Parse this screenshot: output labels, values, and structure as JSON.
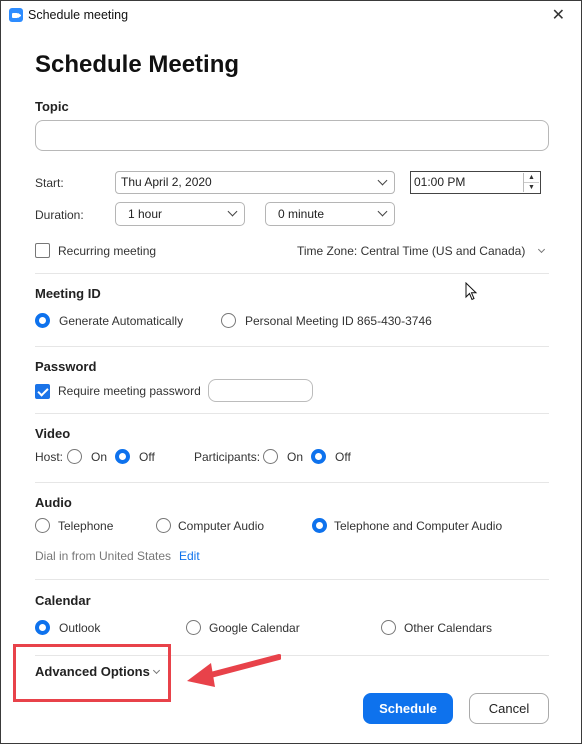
{
  "window": {
    "title": "Schedule meeting",
    "close_glyph": "✕"
  },
  "heading": "Schedule Meeting",
  "topic": {
    "label": "Topic",
    "value": ""
  },
  "start": {
    "label": "Start:",
    "date": "Thu  April 2, 2020",
    "time": "01:00 PM"
  },
  "duration": {
    "label": "Duration:",
    "hours": "1 hour",
    "minutes": "0 minute"
  },
  "recurring": {
    "label": "Recurring meeting",
    "checked": false
  },
  "timezone": {
    "value": "Time Zone: Central Time (US and Canada)"
  },
  "meeting_id": {
    "label": "Meeting ID",
    "options": [
      "Generate Automatically",
      "Personal Meeting ID 865-430-3746"
    ],
    "selected": 0
  },
  "password": {
    "label": "Password",
    "require_label": "Require meeting password",
    "checked": true,
    "value": ""
  },
  "video": {
    "label": "Video",
    "host_label": "Host:",
    "participants_label": "Participants:",
    "on": "On",
    "off": "Off",
    "host_selected": "Off",
    "participants_selected": "Off"
  },
  "audio": {
    "label": "Audio",
    "options": [
      "Telephone",
      "Computer Audio",
      "Telephone and Computer Audio"
    ],
    "selected": 2,
    "dial_in": "Dial in from United States",
    "edit": "Edit"
  },
  "calendar": {
    "label": "Calendar",
    "options": [
      "Outlook",
      "Google Calendar",
      "Other Calendars"
    ],
    "selected": 0
  },
  "advanced": {
    "label": "Advanced Options"
  },
  "buttons": {
    "schedule": "Schedule",
    "cancel": "Cancel"
  },
  "colors": {
    "accent": "#0e72ed",
    "annotation": "#e8424a"
  }
}
